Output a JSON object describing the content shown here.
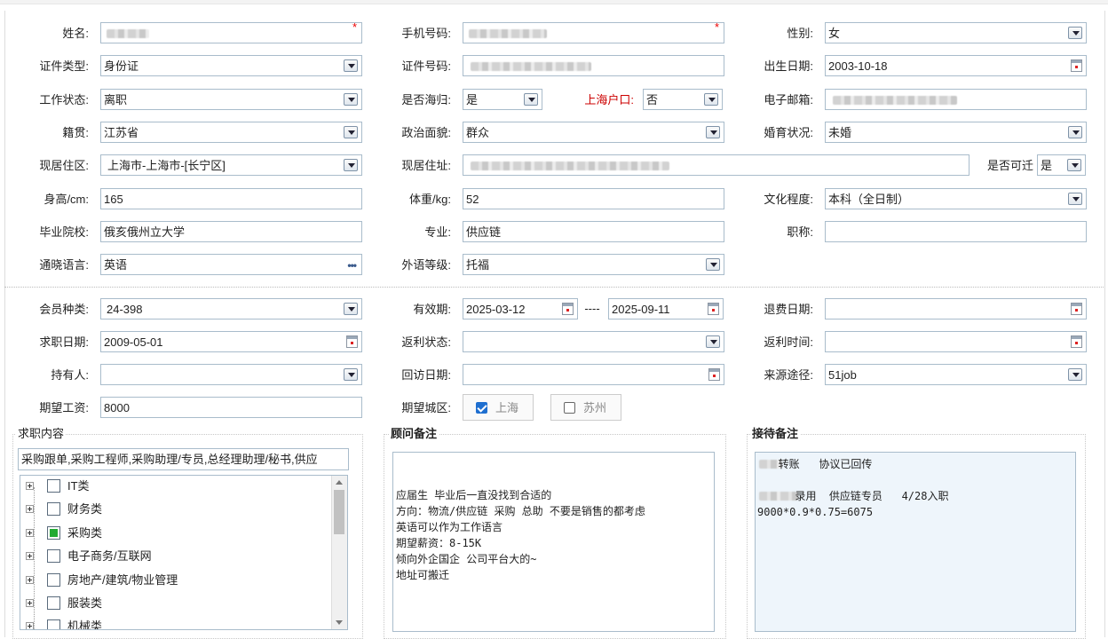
{
  "personal": {
    "name": {
      "label": "姓名:"
    },
    "phone": {
      "label": "手机号码:"
    },
    "gender": {
      "label": "性别:",
      "value": "女"
    },
    "id_type": {
      "label": "证件类型:",
      "value": "身份证"
    },
    "id_number": {
      "label": "证件号码:"
    },
    "birth_date": {
      "label": "出生日期:",
      "value": "2003-10-18"
    },
    "work_status": {
      "label": "工作状态:",
      "value": "离职"
    },
    "returnee": {
      "label": "是否海归:",
      "value": "是"
    },
    "shanghai_hukou": {
      "label": "上海户口:",
      "value": "否"
    },
    "email": {
      "label": "电子邮箱:"
    },
    "native_place": {
      "label": "籍贯:",
      "value": "江苏省"
    },
    "political": {
      "label": "政治面貌:",
      "value": "群众"
    },
    "marital": {
      "label": "婚育状况:",
      "value": "未婚"
    },
    "residence_area": {
      "label": "现居住区:",
      "value": "上海市-上海市-[长宁区]"
    },
    "residence_address": {
      "label": "现居住址:"
    },
    "relocatable": {
      "label": "是否可迁",
      "value": "是"
    },
    "height": {
      "label": "身高/cm:",
      "value": "165"
    },
    "weight": {
      "label": "体重/kg:",
      "value": "52"
    },
    "education": {
      "label": "文化程度:",
      "value": "本科（全日制）"
    },
    "school": {
      "label": "毕业院校:",
      "value": "俄亥俄州立大学"
    },
    "major": {
      "label": "专业:",
      "value": "供应链"
    },
    "title": {
      "label": "职称:",
      "value": ""
    },
    "language": {
      "label": "通晓语言:",
      "value": "英语",
      "more": "•••"
    },
    "language_level": {
      "label": "外语等级:",
      "value": "托福"
    }
  },
  "membership": {
    "member_type": {
      "label": "会员种类:",
      "value": "24-398"
    },
    "valid_period": {
      "label": "有效期:",
      "start": "2025-03-12",
      "separator": "----",
      "end": "2025-09-11"
    },
    "refund_date": {
      "label": "退费日期:",
      "value": ""
    },
    "job_seek_date": {
      "label": "求职日期:",
      "value": "2009-05-01"
    },
    "rebate_status": {
      "label": "返利状态:",
      "value": ""
    },
    "rebate_time": {
      "label": "返利时间:",
      "value": ""
    },
    "holder": {
      "label": "持有人:",
      "value": ""
    },
    "callback_date": {
      "label": "回访日期:",
      "value": ""
    },
    "source": {
      "label": "来源途径:",
      "value": "51job"
    },
    "expected_salary": {
      "label": "期望工资:",
      "value": "8000"
    },
    "expected_city": {
      "label": "期望城区:",
      "options": [
        {
          "label": "上海",
          "checked": true
        },
        {
          "label": "苏州",
          "checked": false
        }
      ]
    }
  },
  "job_content": {
    "legend": "求职内容",
    "summary": "采购跟单,采购工程师,采购助理/专员,总经理助理/秘书,供应",
    "tree": [
      {
        "label": "IT类",
        "state": "unchecked"
      },
      {
        "label": "财务类",
        "state": "unchecked"
      },
      {
        "label": "采购类",
        "state": "partial"
      },
      {
        "label": "电子商务/互联网",
        "state": "unchecked"
      },
      {
        "label": "房地产/建筑/物业管理",
        "state": "unchecked"
      },
      {
        "label": "服装类",
        "state": "unchecked"
      },
      {
        "label": "机械类",
        "state": "unchecked"
      }
    ]
  },
  "advisor_notes": {
    "legend": "顾问备注",
    "text": "\n\n应届生 毕业后一直没找到合适的\n方向：物流/供应链 采购 总助 不要是销售的都考虑\n英语可以作为工作语言\n期望薪资：8-15K\n倾向外企国企 公司平台大的~\n地址可搬迁"
  },
  "reception_notes": {
    "legend": "接待备注",
    "line1": "   转账   协议已回传",
    "line2": "  录用  供应链专员   4/28入职",
    "line3": "9000*0.9*0.75=6075"
  }
}
